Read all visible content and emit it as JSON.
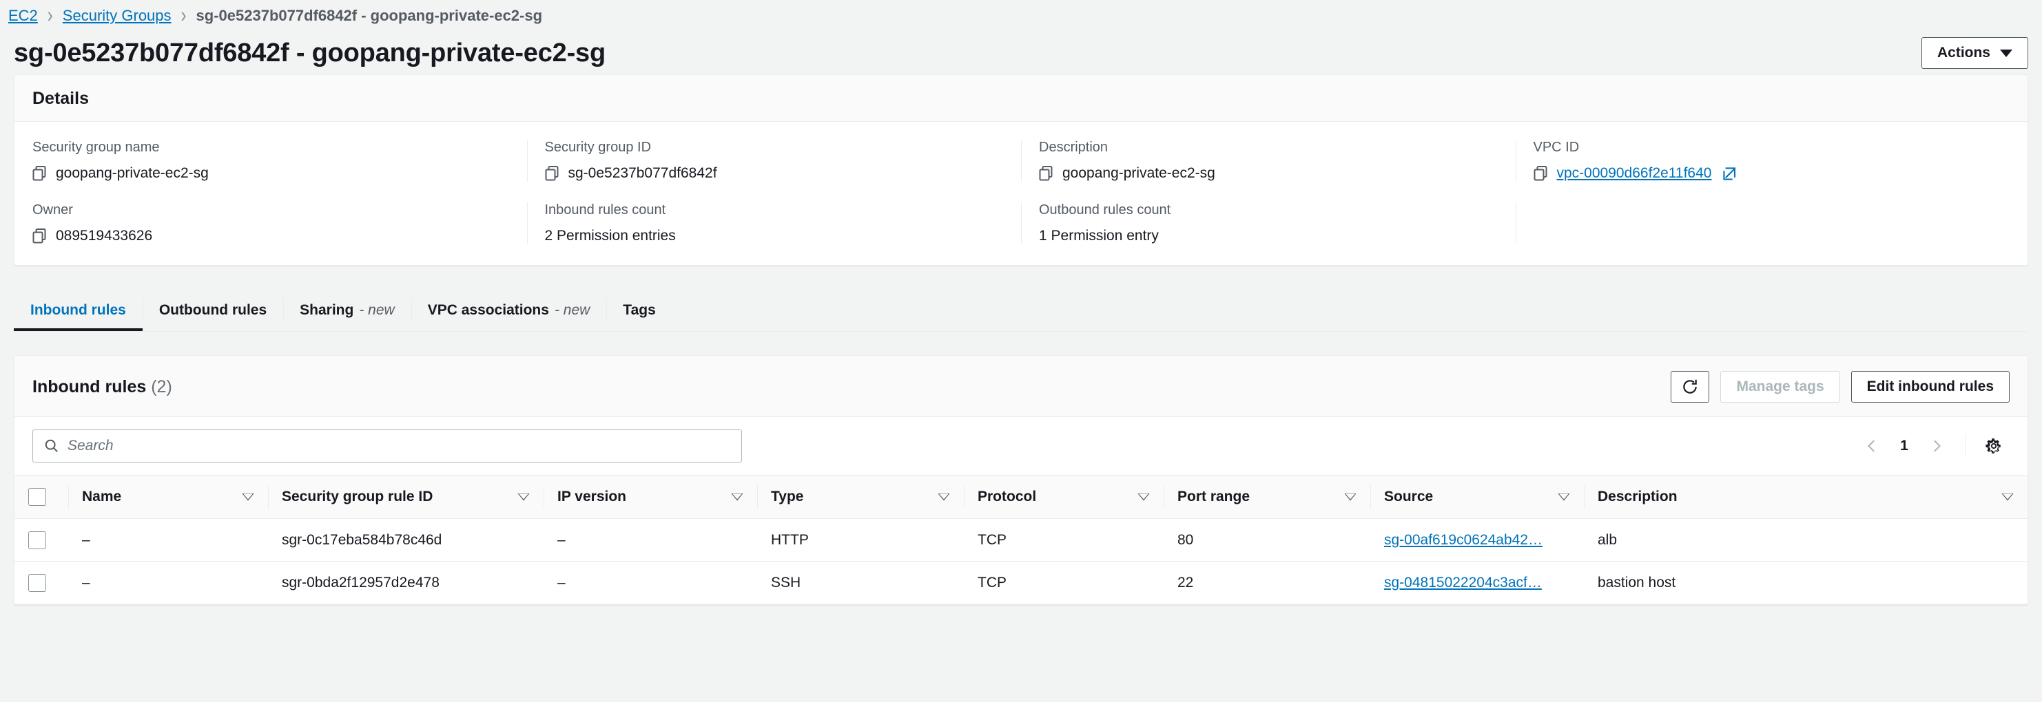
{
  "breadcrumb": {
    "items": [
      {
        "label": "EC2",
        "link": true
      },
      {
        "label": "Security Groups",
        "link": true
      },
      {
        "label": "sg-0e5237b077df6842f - goopang-private-ec2-sg",
        "link": false
      }
    ],
    "separator": "›"
  },
  "header": {
    "title": "sg-0e5237b077df6842f - goopang-private-ec2-sg",
    "actions_label": "Actions"
  },
  "details": {
    "heading": "Details",
    "row1": [
      {
        "label": "Security group name",
        "value": "goopang-private-ec2-sg",
        "copy": true,
        "link": false
      },
      {
        "label": "Security group ID",
        "value": "sg-0e5237b077df6842f",
        "copy": true,
        "link": false
      },
      {
        "label": "Description",
        "value": "goopang-private-ec2-sg",
        "copy": true,
        "link": false
      },
      {
        "label": "VPC ID",
        "value": "vpc-00090d66f2e11f640",
        "copy": true,
        "link": true,
        "external": true
      }
    ],
    "row2": [
      {
        "label": "Owner",
        "value": "089519433626",
        "copy": true,
        "link": false
      },
      {
        "label": "Inbound rules count",
        "value": "2 Permission entries",
        "copy": false,
        "link": false
      },
      {
        "label": "Outbound rules count",
        "value": "1 Permission entry",
        "copy": false,
        "link": false
      },
      {
        "label": "",
        "value": "",
        "copy": false,
        "link": false
      }
    ]
  },
  "tabs": [
    {
      "label": "Inbound rules",
      "badge": "",
      "active": true
    },
    {
      "label": "Outbound rules",
      "badge": "",
      "active": false
    },
    {
      "label": "Sharing",
      "badge": "- new",
      "active": false
    },
    {
      "label": "VPC associations",
      "badge": "- new",
      "active": false
    },
    {
      "label": "Tags",
      "badge": "",
      "active": false
    }
  ],
  "rules_panel": {
    "title": "Inbound rules",
    "count": "(2)",
    "refresh_label": "refresh-icon",
    "manage_tags_label": "Manage tags",
    "edit_label": "Edit inbound rules",
    "search_placeholder": "Search",
    "page_number": "1",
    "columns": [
      "Name",
      "Security group rule ID",
      "IP version",
      "Type",
      "Protocol",
      "Port range",
      "Source",
      "Description"
    ],
    "rows": [
      {
        "name": "–",
        "rule_id": "sgr-0c17eba584b78c46d",
        "ip_version": "–",
        "type": "HTTP",
        "protocol": "TCP",
        "port_range": "80",
        "source": "sg-00af619c0624ab42…",
        "description": "alb"
      },
      {
        "name": "–",
        "rule_id": "sgr-0bda2f12957d2e478",
        "ip_version": "–",
        "type": "SSH",
        "protocol": "TCP",
        "port_range": "22",
        "source": "sg-04815022204c3acf…",
        "description": "bastion host"
      }
    ]
  },
  "colors": {
    "link": "#0073bb",
    "text": "#16191f",
    "muted": "#545b64",
    "bg": "#f2f3f3",
    "border": "#eaeded"
  }
}
